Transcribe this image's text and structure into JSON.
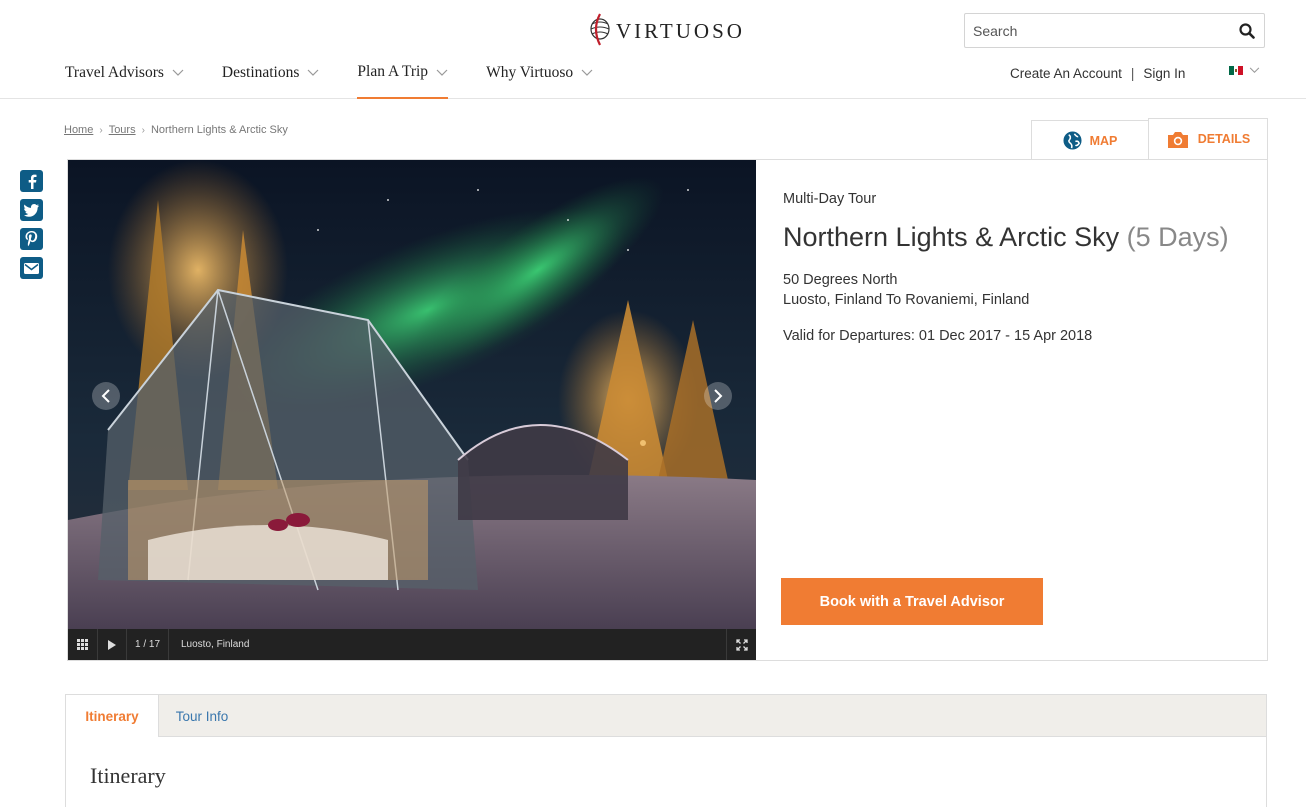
{
  "header": {
    "logo_text": "Virtuoso",
    "search": {
      "placeholder": "Search"
    },
    "nav": [
      {
        "label": "Travel Advisors"
      },
      {
        "label": "Destinations"
      },
      {
        "label": "Plan A Trip",
        "active": true
      },
      {
        "label": "Why Virtuoso"
      }
    ],
    "account": {
      "create": "Create An Account",
      "separator": "|",
      "signin": "Sign In"
    },
    "language_flag": "mexico-flag"
  },
  "breadcrumb": {
    "items": [
      "Home",
      "Tours"
    ],
    "current": "Northern Lights & Arctic Sky"
  },
  "view_tabs": {
    "map": "MAP",
    "details": "DETAILS"
  },
  "share": [
    "facebook-icon",
    "twitter-icon",
    "pinterest-icon",
    "email-icon"
  ],
  "gallery": {
    "counter": "1 / 17",
    "caption": "Luosto, Finland"
  },
  "tour": {
    "type": "Multi-Day Tour",
    "title": "Northern Lights & Arctic Sky",
    "duration": "(5 Days)",
    "operator": "50 Degrees North",
    "route": "Luosto, Finland To Rovaniemi, Finland",
    "valid": "Valid for Departures: 01 Dec 2017 - 15 Apr 2018",
    "book_label": "Book with a Travel Advisor"
  },
  "itinerary": {
    "tabs": [
      "Itinerary",
      "Tour Info"
    ],
    "heading": "Itinerary"
  },
  "colors": {
    "accent": "#f07c33",
    "share_blue": "#0e5c86",
    "link_blue": "#3a77ad"
  }
}
